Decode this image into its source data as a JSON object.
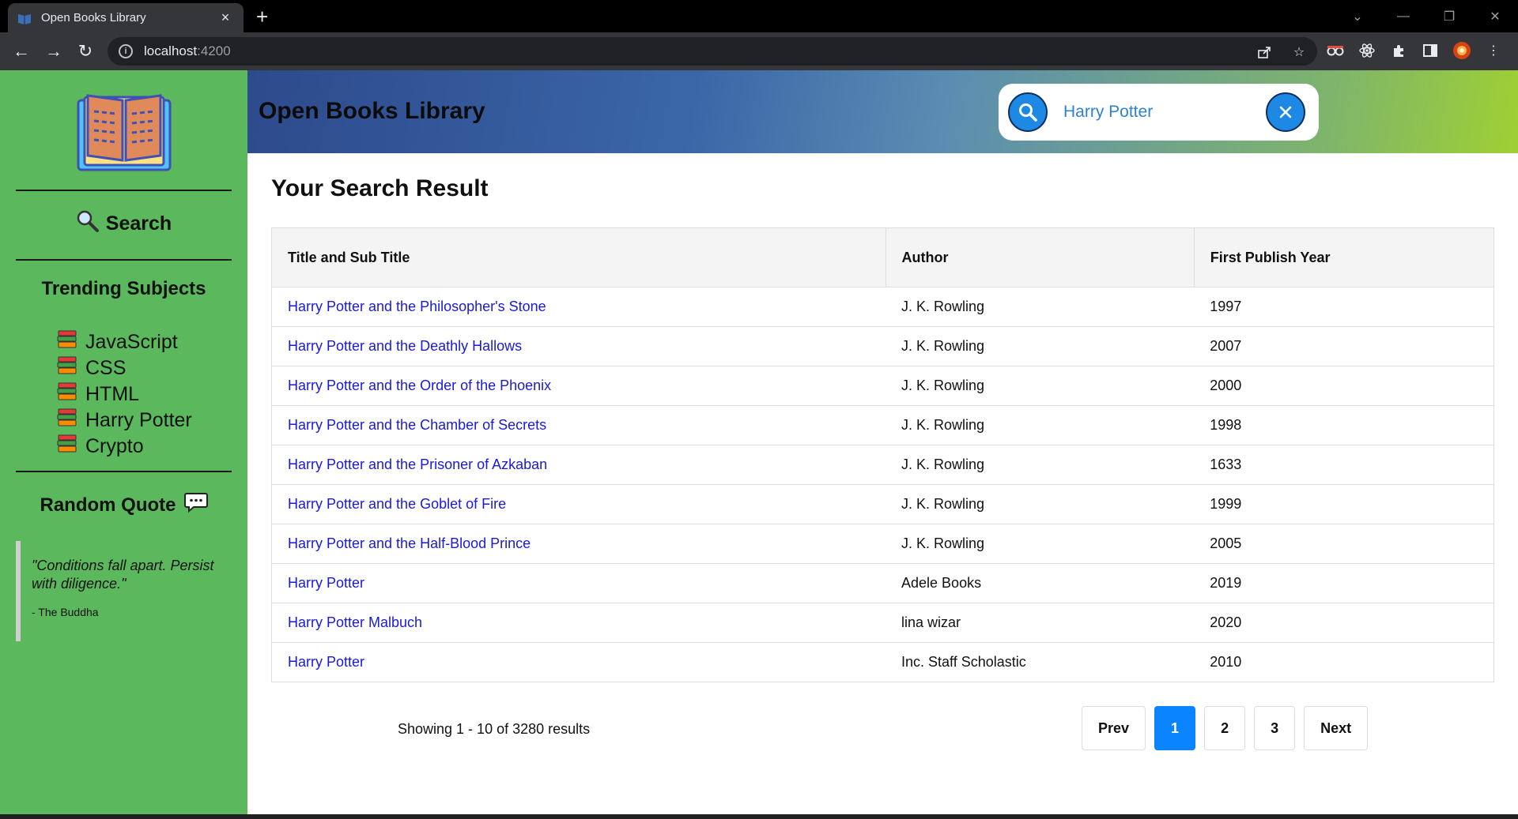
{
  "browser": {
    "tab_title": "Open Books Library",
    "tab_close": "×",
    "new_tab": "+",
    "url_host": "localhost",
    "url_port": ":4200"
  },
  "sidebar": {
    "search_label": "Search",
    "trending_title": "Trending Subjects",
    "subjects": [
      "JavaScript",
      "CSS",
      "HTML",
      "Harry Potter",
      "Crypto"
    ],
    "quote_title": "Random Quote",
    "quote_text": "\"Conditions fall apart. Persist with diligence.\"",
    "quote_author": "- The Buddha"
  },
  "header": {
    "title": "Open Books Library",
    "search_value": "Harry Potter"
  },
  "results": {
    "title": "Your Search Result",
    "columns": [
      "Title and Sub Title",
      "Author",
      "First Publish Year"
    ],
    "rows": [
      {
        "title": "Harry Potter and the Philosopher's Stone",
        "author": "J. K. Rowling",
        "year": "1997"
      },
      {
        "title": "Harry Potter and the Deathly Hallows",
        "author": "J. K. Rowling",
        "year": "2007"
      },
      {
        "title": "Harry Potter and the Order of the Phoenix",
        "author": "J. K. Rowling",
        "year": "2000"
      },
      {
        "title": "Harry Potter and the Chamber of Secrets",
        "author": "J. K. Rowling",
        "year": "1998"
      },
      {
        "title": "Harry Potter and the Prisoner of Azkaban",
        "author": "J. K. Rowling",
        "year": "1633"
      },
      {
        "title": "Harry Potter and the Goblet of Fire",
        "author": "J. K. Rowling",
        "year": "1999"
      },
      {
        "title": "Harry Potter and the Half-Blood Prince",
        "author": "J. K. Rowling",
        "year": "2005"
      },
      {
        "title": "Harry Potter",
        "author": "Adele Books",
        "year": "2019"
      },
      {
        "title": "Harry Potter Malbuch",
        "author": "lina wizar",
        "year": "2020"
      },
      {
        "title": "Harry Potter",
        "author": "Inc. Staff Scholastic",
        "year": "2010"
      }
    ],
    "showing_text": "Showing 1 - 10 of 3280 results",
    "pager": {
      "prev": "Prev",
      "pages": [
        "1",
        "2",
        "3"
      ],
      "active_page": "1",
      "next": "Next"
    }
  },
  "colors": {
    "sidebar": "#5cb85c",
    "accent_blue": "#1e88e5",
    "link": "#1a1ad6",
    "active_page": "#0a84ff"
  }
}
